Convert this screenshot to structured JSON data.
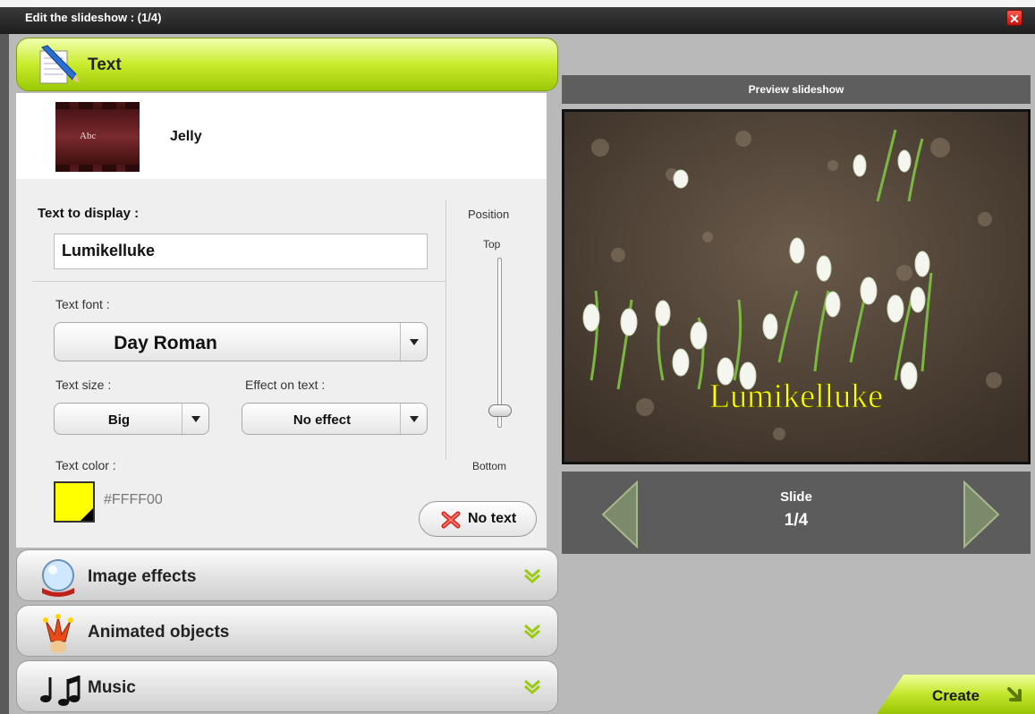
{
  "window": {
    "title": "Edit the slideshow : (1/4)",
    "close_label": "✕"
  },
  "sections": {
    "text": "Text",
    "image_effects": "Image effects",
    "animated_objects": "Animated objects",
    "music": "Music"
  },
  "theme": {
    "thumbnail_text": "Abc",
    "name": "Jelly"
  },
  "text_panel": {
    "display_label": "Text to display :",
    "display_value": "Lumikelluke",
    "font_label": "Text font :",
    "font_value": "Day Roman",
    "size_label": "Text size :",
    "size_value": "Big",
    "effect_label": "Effect on text :",
    "effect_value": "No effect",
    "color_label": "Text color :",
    "color_value": "#FFFF00",
    "no_text_label": "No text",
    "position_label": "Position",
    "position_top": "Top",
    "position_bottom": "Bottom",
    "position_level": 0.93
  },
  "preview": {
    "header": "Preview slideshow",
    "overlay_text": "Lumikelluke",
    "overlay_color": "#FFFF00",
    "slide_label": "Slide",
    "slide_counter": "1/4"
  },
  "actions": {
    "create_label": "Create"
  },
  "colors": {
    "accent_green": "#b4dc1a",
    "close_red": "#d81e12"
  }
}
